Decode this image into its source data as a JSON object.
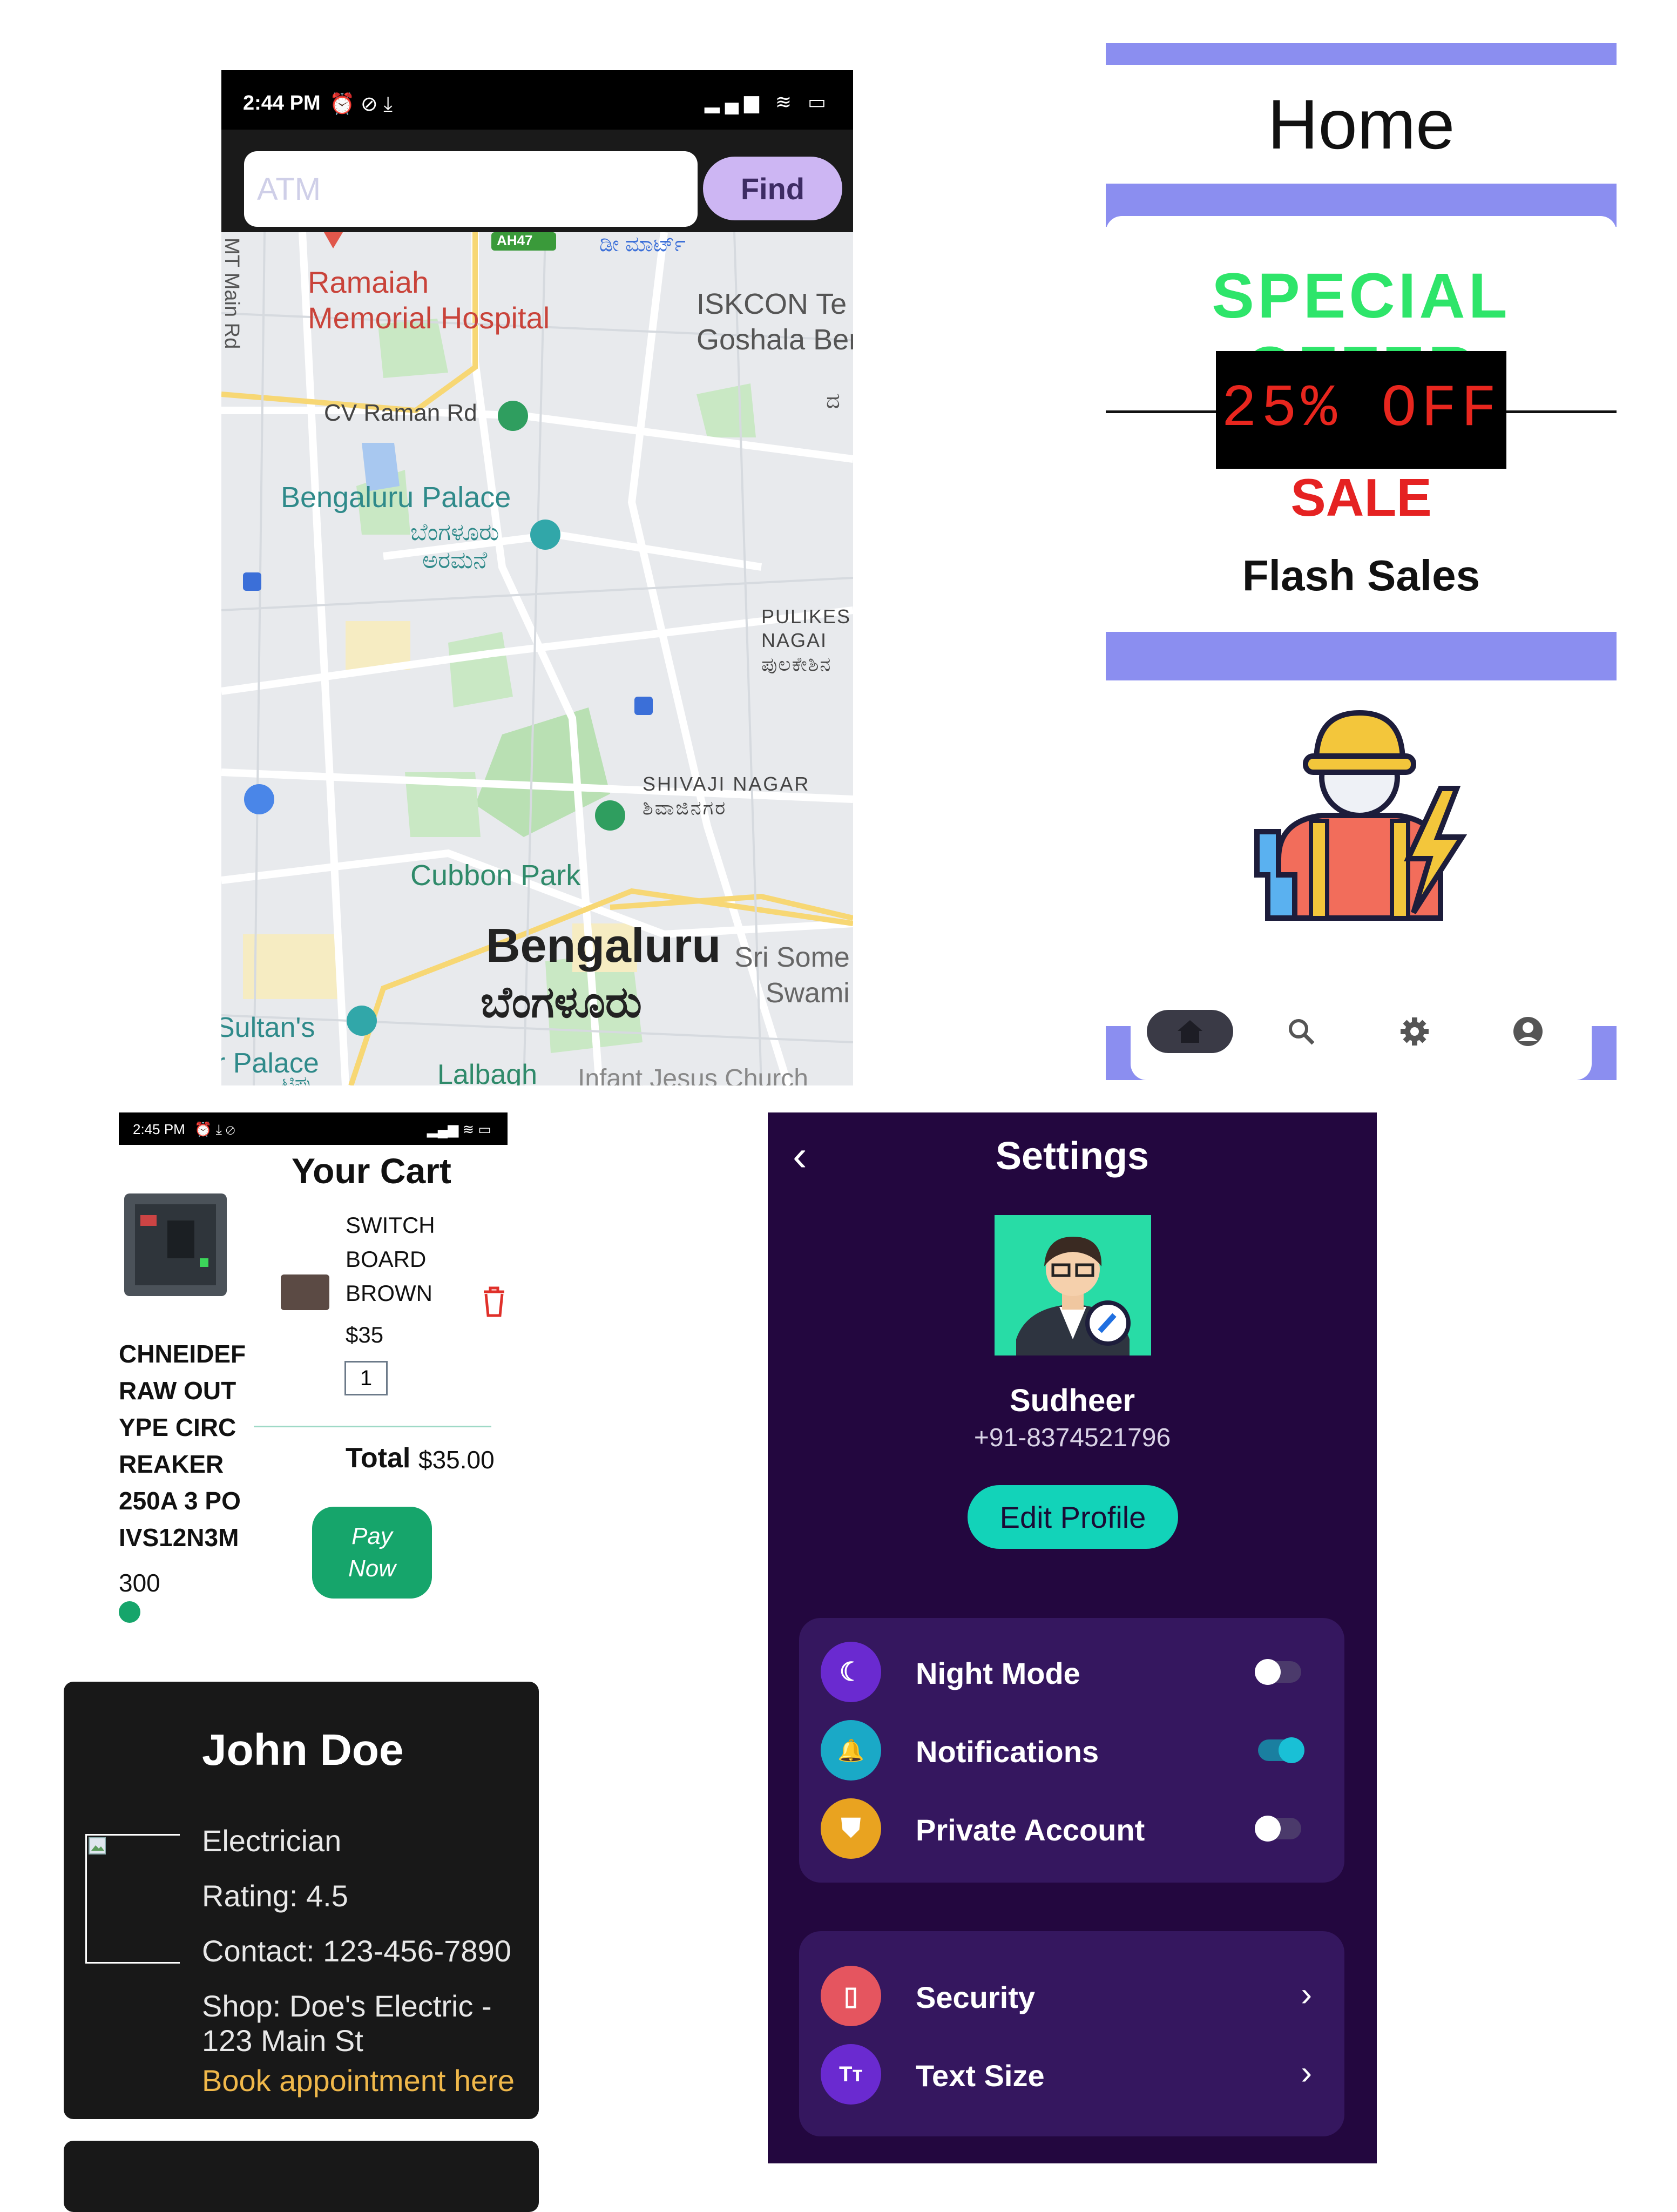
{
  "map_app": {
    "status_time": "2:44 PM",
    "status_icons": "⏰ ⊘ ⤓",
    "status_right": "▂▄▆ ≋ ▭",
    "search_placeholder": "ATM",
    "find_label": "Find",
    "labels": {
      "ramaiah": "Ramaiah\nMemorial Hospital",
      "mt_main_rd": "MT Main Rd",
      "ah47": "AH47",
      "dmart": "ಡೀ ಮಾರ್ಟ್",
      "iskcon": "ISKCON Te\nGoshala Ber",
      "cv_raman": "CV Raman Rd",
      "palace_en": "Bengaluru Palace",
      "palace_kn": "ಬೆಂಗಳೂರು\nಅರಮನೆ",
      "pulikeshi": "PULIKES\nNAGAI\nಪುಲಕೇಶಿನ",
      "shivaji": "SHIVAJI NAGAR\nಶಿವಾಜಿನಗರ",
      "cubbon": "Cubbon Park",
      "city_en": "Bengaluru",
      "city_kn": "ಬೆಂಗಳೂರು",
      "sri_some": "Sri Some\nSwami",
      "sultan": "Sultan's\nr Palace",
      "sultan_kn": "ಟಿಪ್ಪು\nಸುಲ್ತಾನ...",
      "lalbagh": "Lalbagh",
      "infant": "Infant Jesus Church",
      "right_kn": "ದ"
    }
  },
  "home": {
    "title": "Home",
    "special": "SPECIAL OFFER",
    "discount": "25% OFF",
    "sale": "SALE",
    "flash": "Flash Sales"
  },
  "cart": {
    "status_time": "2:45 PM",
    "status_icons": "⏰ ⤓ ⊘",
    "status_right": "▂▄▆ ≋ ▭",
    "title": "Your Cart",
    "product_lines": [
      "CHNEIDEF",
      "RAW OUT",
      "YPE CIRC",
      "REAKER",
      "250A 3 PO",
      "IVS12N3M",
      "300"
    ],
    "item_name_lines": [
      "SWITCH",
      "BOARD",
      "BROWN"
    ],
    "item_price": "$35",
    "item_qty": "1",
    "total_label": "Total",
    "total_value": "$35.00",
    "pay_label_1": "Pay",
    "pay_label_2": "Now"
  },
  "profile": {
    "name": "John Doe",
    "role": "Electrician",
    "rating": "Rating: 4.5",
    "contact": "Contact: 123-456-7890",
    "shop_1": "Shop: Doe's Electric -",
    "shop_2": "123 Main St",
    "link": "Book appointment here"
  },
  "settings": {
    "title": "Settings",
    "back": "‹",
    "user_name": "Sudheer",
    "user_phone": "+91-8374521796",
    "edit_label": "Edit Profile",
    "toggles": [
      {
        "label": "Night Mode",
        "icon": "moon-icon",
        "glyph": "☾",
        "color": "#6a2ad0",
        "on": false
      },
      {
        "label": "Notifications",
        "icon": "bell-icon",
        "glyph": "🔔",
        "color": "#1aa9c7",
        "on": true
      },
      {
        "label": "Private Account",
        "icon": "shield-icon",
        "glyph": "⛊",
        "color": "#e9a320",
        "on": false
      }
    ],
    "links": [
      {
        "label": "Security",
        "icon": "lock-icon",
        "glyph": "▯",
        "color": "#e5555f"
      },
      {
        "label": "Text Size",
        "icon": "text-size-icon",
        "glyph": "Tт",
        "color": "#6a2ad0"
      }
    ],
    "colors": {
      "bg": "#23073f",
      "group": "#35175f",
      "accent": "#12d3b9"
    }
  }
}
